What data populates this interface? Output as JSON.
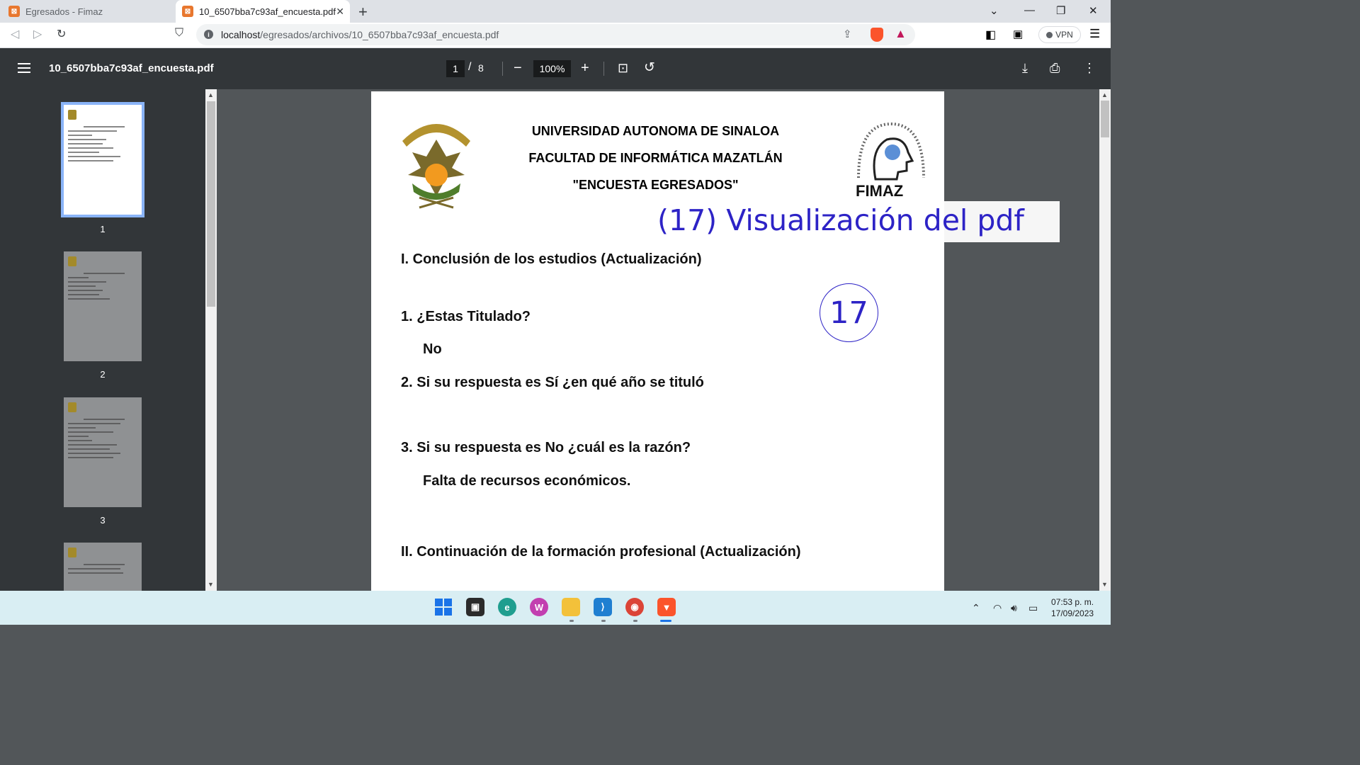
{
  "browser": {
    "tabs": [
      {
        "title": "Egresados - Fimaz",
        "favicon": "xampp-favicon",
        "active": false
      },
      {
        "title": "10_6507bba7c93af_encuesta.pdf",
        "favicon": "xampp-favicon",
        "active": true
      }
    ],
    "url_host": "localhost",
    "url_path": "/egresados/archivos/10_6507bba7c93af_encuesta.pdf",
    "vpn_label": "VPN"
  },
  "pdf_viewer": {
    "file_name": "10_6507bba7c93af_encuesta.pdf",
    "current_page": "1",
    "page_separator": "/",
    "total_pages": "8",
    "zoom": "100%",
    "thumbnails": [
      {
        "label": "1"
      },
      {
        "label": "2"
      },
      {
        "label": "3"
      }
    ]
  },
  "document": {
    "header": [
      "UNIVERSIDAD AUTONOMA DE SINALOA",
      "FACULTAD DE INFORMÁTICA MAZATLÁN",
      "\"ENCUESTA EGRESADOS\""
    ],
    "logo_text": "FIMAZ",
    "section1": "I. Conclusión de los estudios (Actualización)",
    "q1": "1. ¿Estas Titulado?",
    "a1": "No",
    "q2": "2. Si su respuesta es Sí ¿en qué año se tituló",
    "q3": "3. Si su respuesta es No ¿cuál es la razón?",
    "a3": "Falta de recursos económicos.",
    "section2": "II. Continuación de la formación profesional (Actualización)"
  },
  "overlay": {
    "label": "(17) Visualización del pdf",
    "badge": "17"
  },
  "taskbar": {
    "time": "07:53 p. m.",
    "date": "17/09/2023"
  }
}
